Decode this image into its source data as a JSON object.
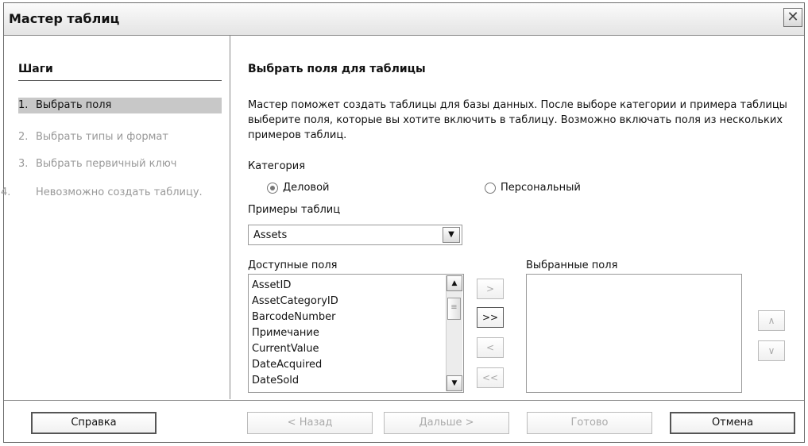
{
  "window": {
    "title": "Мастер таблиц"
  },
  "steps": {
    "title": "Шаги",
    "items": [
      {
        "num": "1.",
        "label": "Выбрать поля"
      },
      {
        "num": "2.",
        "label": "Выбрать типы и формат"
      },
      {
        "num": "3.",
        "label": "Выбрать первичный ключ"
      },
      {
        "num": "4.",
        "label": "Невозможно создать таблицу."
      }
    ]
  },
  "main": {
    "heading": "Выбрать поля для таблицы",
    "description": "Мастер поможет создать таблицы для базы данных. После выборе категории и примера таблицы выберите поля, которые вы хотите включить в таблицу. Возможно включать поля из нескольких примеров таблиц.",
    "category": {
      "label": "Категория",
      "options": [
        {
          "label": "Деловой",
          "checked": true
        },
        {
          "label": "Персональный",
          "checked": false
        }
      ]
    },
    "examples": {
      "label": "Примеры таблиц",
      "value": "Assets"
    },
    "available": {
      "label": "Доступные поля",
      "items": [
        "AssetID",
        "AssetCategoryID",
        "BarcodeNumber",
        "Примечание",
        "CurrentValue",
        "DateAcquired",
        "DateSold"
      ]
    },
    "selected": {
      "label": "Выбранные поля",
      "items": []
    },
    "buttons": {
      "add": ">",
      "add_all": ">>",
      "remove": "<",
      "remove_all": "<<",
      "up": "∧",
      "down": "∨"
    }
  },
  "footer": {
    "help": "Справка",
    "back": "< Назад",
    "next": "Дальше >",
    "finish": "Готово",
    "cancel": "Отмена"
  },
  "colors": {
    "active_step_bg": "#c8c8c8",
    "disabled_text": "#999999"
  }
}
